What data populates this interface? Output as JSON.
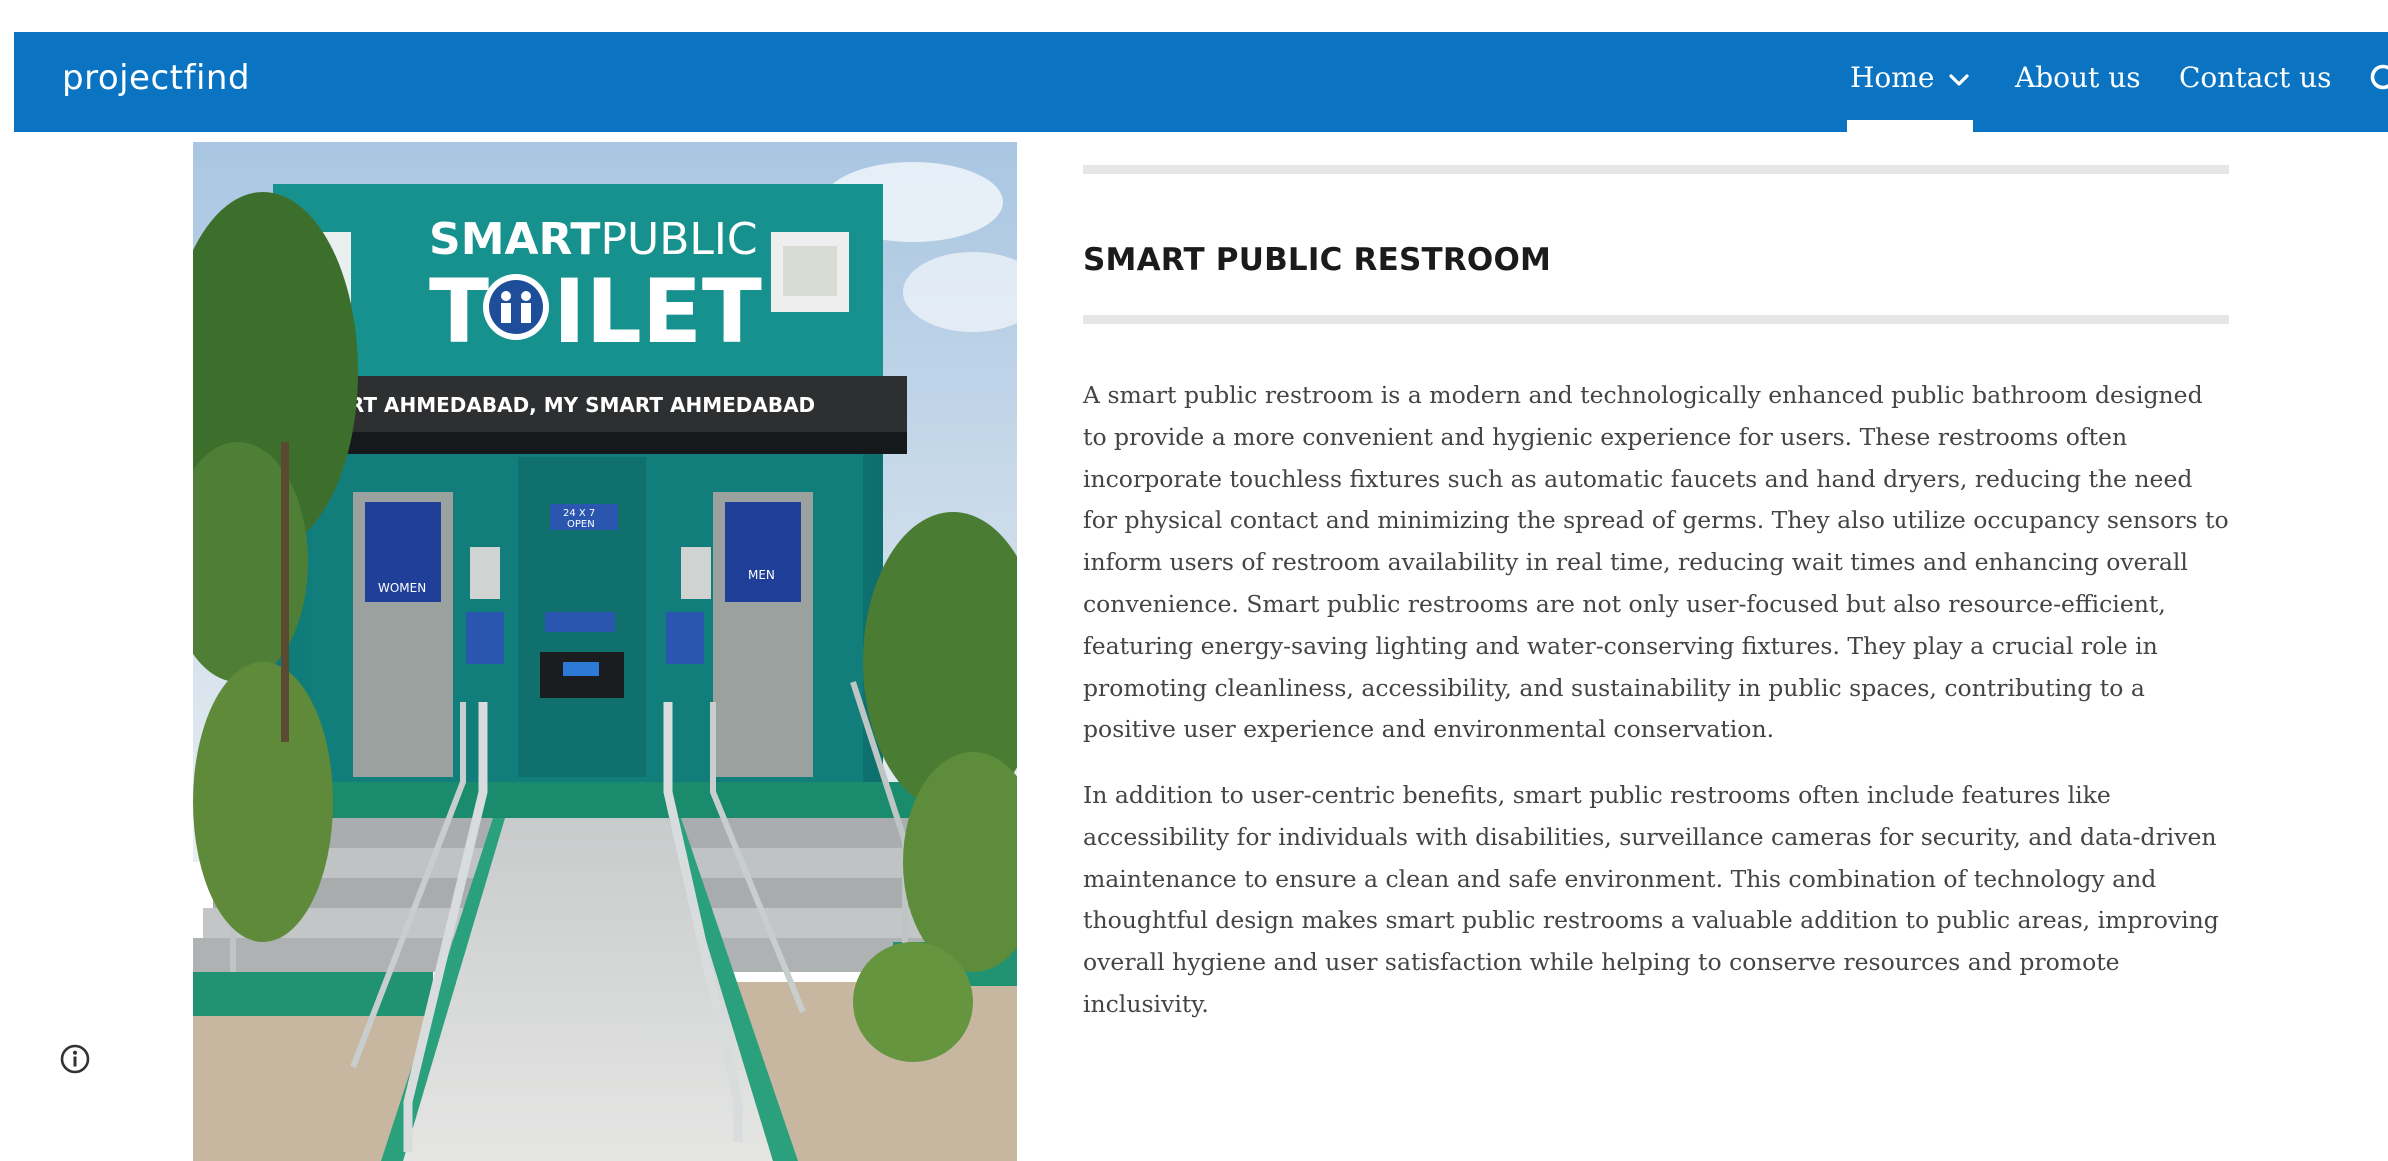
{
  "header": {
    "brand": "projectfind",
    "nav": [
      {
        "label": "Home"
      },
      {
        "label": "About us"
      },
      {
        "label": "Contact us"
      }
    ]
  },
  "photo": {
    "sign_main_1": "SMART",
    "sign_main_2": "PUBLIC",
    "sign_big_1": "T",
    "sign_big_2": "ILET",
    "banner": "HEART AHMEDABAD, MY SMART AHMEDABAD",
    "open_sign_1": "24 X 7",
    "open_sign_2": "OPEN",
    "women_label": "WOMEN",
    "men_label": "MEN"
  },
  "article": {
    "title": "SMART PUBLIC RESTROOM",
    "paragraphs": [
      "A smart public restroom is a modern and technologically enhanced public bathroom designed to provide a more convenient and hygienic experience for users. These restrooms often incorporate touchless fixtures such as automatic faucets and hand dryers, reducing the need for physical contact and minimizing the spread of germs. They also utilize occupancy sensors to inform users of restroom availability in real time, reducing wait times and enhancing overall convenience. Smart public restrooms are not only user-focused but also resource-efficient, featuring energy-saving lighting and water-conserving fixtures. They play a crucial role in promoting cleanliness, accessibility, and sustainability in public spaces, contributing to a positive user experience and environmental conservation.",
      "In addition to user-centric benefits, smart public restrooms often include features like accessibility for individuals with disabilities, surveillance cameras for security, and data-driven maintenance to ensure a clean and safe environment. This combination of technology and thoughtful design makes smart public restrooms a valuable addition to public areas, improving overall hygiene and user satisfaction while helping to conserve resources and promote inclusivity."
    ]
  },
  "icons": {
    "search": "search-icon",
    "chevron": "chevron-down-icon",
    "info": "info-icon"
  },
  "colors": {
    "header_bg": "#0a74c2",
    "header_text": "#ffffff",
    "title_text": "#1b1b1b",
    "body_text": "#444444",
    "divider": "#e6e6e6"
  }
}
